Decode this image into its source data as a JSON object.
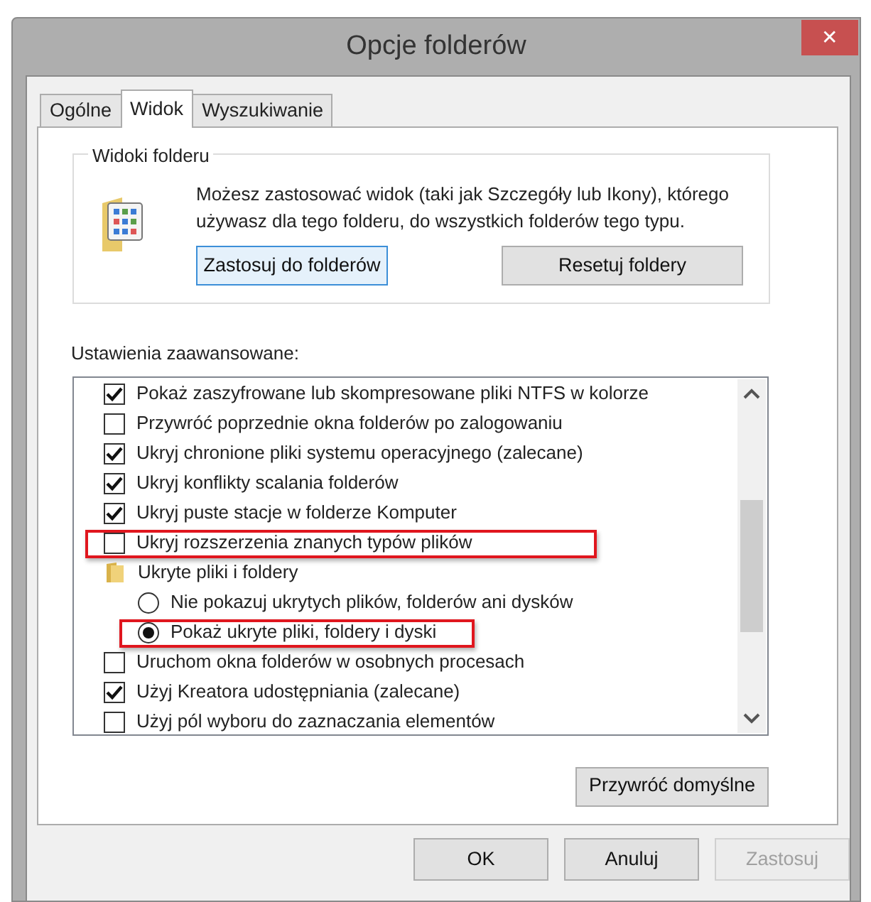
{
  "window": {
    "title": "Opcje folderów",
    "close": "✕"
  },
  "tabs": [
    {
      "label": "Ogólne",
      "selected": false
    },
    {
      "label": "Widok",
      "selected": true
    },
    {
      "label": "Wyszukiwanie",
      "selected": false
    }
  ],
  "folder_views": {
    "title": "Widoki folderu",
    "description": "Możesz zastosować widok (taki jak Szczegóły lub Ikony), którego używasz dla tego folderu, do wszystkich folderów tego typu.",
    "buttons": [
      {
        "label": "Zastosuj do folderów",
        "focused": true
      },
      {
        "label": "Resetuj foldery",
        "focused": false
      }
    ]
  },
  "advanced": {
    "label": "Ustawienia zaawansowane:",
    "items": [
      {
        "kind": "checkbox",
        "label": "Pokaż zaszyfrowane lub skompresowane pliki NTFS w kolorze",
        "checked": true,
        "highlighted": false
      },
      {
        "kind": "checkbox",
        "label": "Przywróć poprzednie okna folderów po zalogowaniu",
        "checked": false,
        "highlighted": false
      },
      {
        "kind": "checkbox",
        "label": "Ukryj chronione pliki systemu operacyjnego (zalecane)",
        "checked": true,
        "highlighted": false
      },
      {
        "kind": "checkbox",
        "label": "Ukryj konflikty scalania folderów",
        "checked": true,
        "highlighted": false
      },
      {
        "kind": "checkbox",
        "label": "Ukryj puste stacje w folderze Komputer",
        "checked": true,
        "highlighted": false
      },
      {
        "kind": "checkbox",
        "label": "Ukryj rozszerzenia znanych typów plików",
        "checked": false,
        "highlighted": true
      },
      {
        "kind": "folder",
        "label": "Ukryte pliki i foldery",
        "highlighted": false,
        "children": [
          {
            "kind": "radio",
            "label": "Nie pokazuj ukrytych plików, folderów ani dysków",
            "selected": false,
            "highlighted": false
          },
          {
            "kind": "radio",
            "label": "Pokaż ukryte pliki, foldery i dyski",
            "selected": true,
            "highlighted": true
          }
        ]
      },
      {
        "kind": "checkbox",
        "label": "Uruchom okna folderów w osobnych procesach",
        "checked": false,
        "highlighted": false
      },
      {
        "kind": "checkbox",
        "label": "Użyj Kreatora udostępniania (zalecane)",
        "checked": true,
        "highlighted": false
      },
      {
        "kind": "checkbox",
        "label": "Użyj pól wyboru do zaznaczania elementów",
        "checked": false,
        "highlighted": false
      }
    ],
    "restore_button": "Przywróć domyślne"
  },
  "buttons": [
    {
      "label": "OK",
      "disabled": false
    },
    {
      "label": "Anuluj",
      "disabled": false
    },
    {
      "label": "Zastosuj",
      "disabled": true
    }
  ]
}
